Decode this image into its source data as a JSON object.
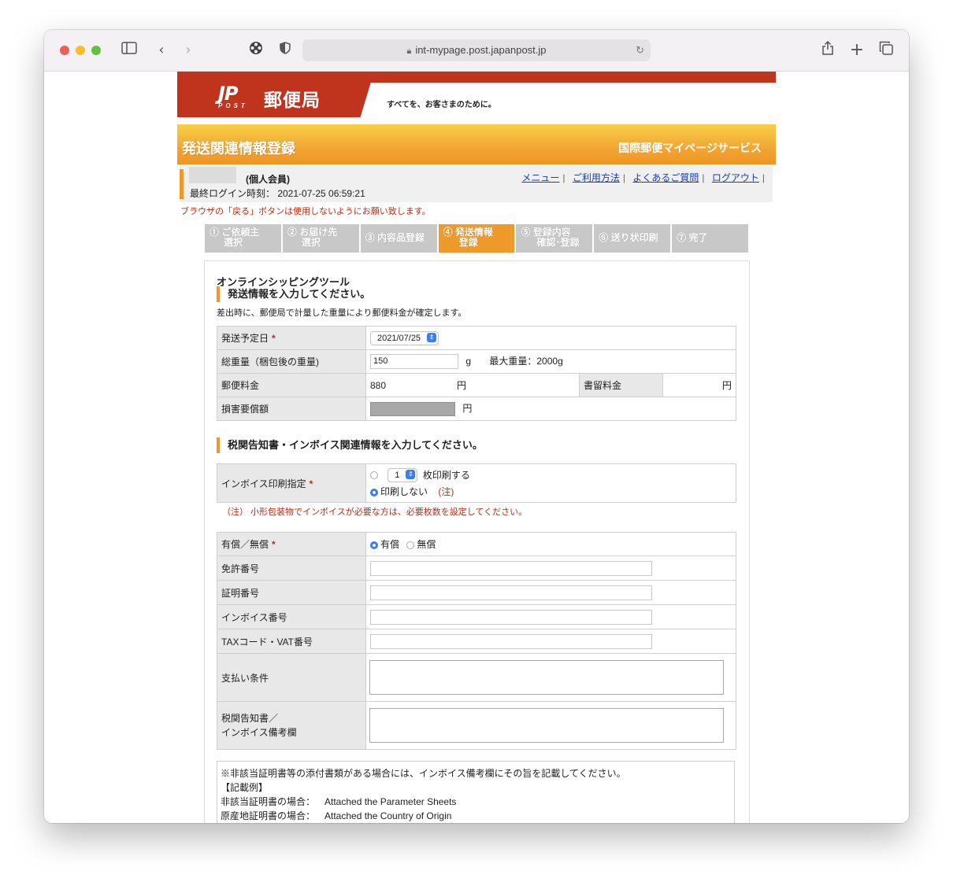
{
  "browser": {
    "url": "int-mypage.post.japanpost.jp"
  },
  "header": {
    "logo_mark": "JP",
    "logo_post": "POST",
    "logo_name": "郵便局",
    "slogan": "すべてを、お客さまのために。",
    "banner_title": "発送関連情報登録",
    "banner_service": "国際郵便マイページサービス"
  },
  "member": {
    "type": "(個人会員)",
    "last_login": "最終ログイン時刻： 2021-07-25 06:59:21",
    "links": [
      "メニュー",
      "ご利用方法",
      "よくあるご質問",
      "ログアウト"
    ]
  },
  "warning": "ブラウザの「戻る」ボタンは使用しないようにお願い致します。",
  "steps": [
    {
      "line1": "① ご依頼主",
      "line2": "選択"
    },
    {
      "line1": "② お届け先",
      "line2": "選択"
    },
    {
      "line1": "③ 内容品登録",
      "line2": ""
    },
    {
      "line1": "④ 発送情報",
      "line2": "登録"
    },
    {
      "line1": "⑤ 登録内容",
      "line2": "確認･登録"
    },
    {
      "line1": "⑥ 送り状印刷",
      "line2": ""
    },
    {
      "line1": "⑦ 完了",
      "line2": ""
    }
  ],
  "form": {
    "tool_title": "オンラインシッピングツール",
    "section1_title": "発送情報を入力してください。",
    "section1_note": "差出時に、郵便局で計量した重量により郵便料金が確定します。",
    "ship_date_label": "発送予定日",
    "ship_date": "2021/07/25",
    "weight_label": "総重量（梱包後の重量)",
    "weight": "150",
    "weight_unit": "g",
    "max_weight": "最大重量：2000g",
    "postage_label": "郵便料金",
    "postage": "880",
    "yen": "円",
    "registered_label": "書留料金",
    "damage_label": "損害要償額",
    "section2_title": "税関告知書・インボイス関連情報を入力してください。",
    "invoice_print_label": "インボイス印刷指定",
    "invoice_copies": "1",
    "invoice_print_option": "枚印刷する",
    "invoice_no_print": "印刷しない",
    "note_mark": "(注)",
    "invoice_note": "（注） 小形包装物でインボイスが必要な方は、必要枚数を設定してください。",
    "paid_label": "有償／無償",
    "paid": "有償",
    "free": "無償",
    "license_label": "免許番号",
    "cert_label": "証明番号",
    "invoice_no_label": "インボイス番号",
    "tax_label": "TAXコード・VAT番号",
    "payment_terms_label": "支払い条件",
    "remarks_label_1": "税関告知書／",
    "remarks_label_2": "インボイス備考欄",
    "info_line1": "※非該当証明書等の添付書類がある場合には、インボイス備考欄にその旨を記載してください。",
    "info_line2": "【記載例】",
    "info_row1_label": "非該当証明書の場合：",
    "info_row1_value": "Attached the Parameter Sheets",
    "info_row2_label": "原産地証明書の場合：",
    "info_row2_value": "Attached the Country of Origin"
  }
}
